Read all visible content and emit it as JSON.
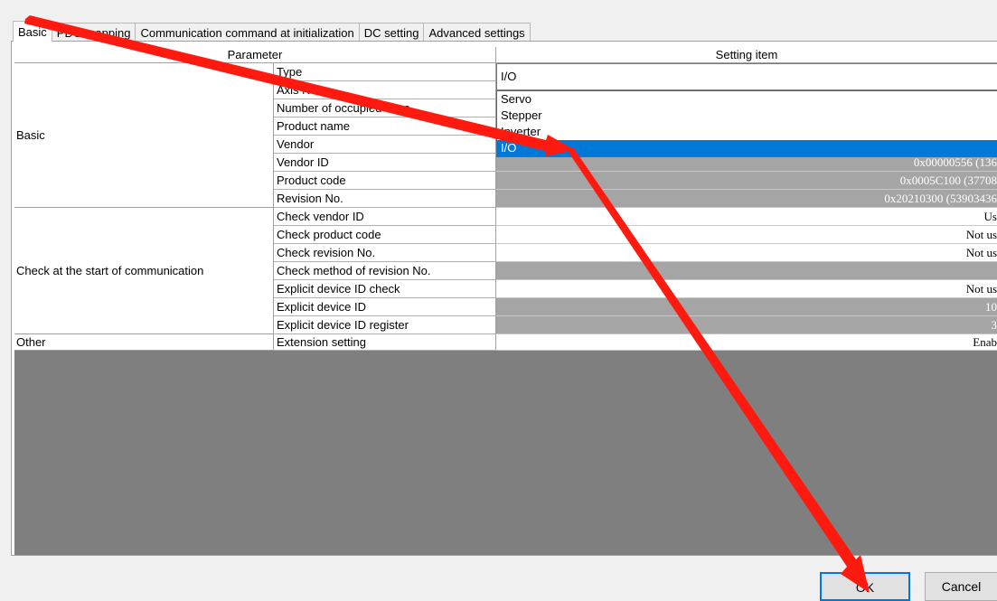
{
  "tabs": [
    "Basic",
    "PDO mapping",
    "Communication command at initialization",
    "DC setting",
    "Advanced settings"
  ],
  "header": {
    "parameter": "Parameter",
    "setting_item": "Setting item"
  },
  "groups": {
    "basic": "Basic",
    "check": "Check at the start of communication",
    "other": "Other"
  },
  "rows": [
    {
      "name": "Type",
      "value": ""
    },
    {
      "name": "Axis No.",
      "value": ""
    },
    {
      "name": "Number of occupied axes",
      "value": ""
    },
    {
      "name": "Product name",
      "value": ""
    },
    {
      "name": "Vendor",
      "value": ""
    },
    {
      "name": "Vendor ID",
      "value": "0x00000556 (136"
    },
    {
      "name": "Product code",
      "value": "0x0005C100 (37708"
    },
    {
      "name": "Revision No.",
      "value": "0x20210300 (53903436"
    },
    {
      "name": "Check vendor ID",
      "value": "Us"
    },
    {
      "name": "Check product code",
      "value": "Not us"
    },
    {
      "name": "Check revision No.",
      "value": "Not us"
    },
    {
      "name": "Check method of revision No.",
      "value": ""
    },
    {
      "name": "Explicit device ID check",
      "value": "Not us"
    },
    {
      "name": "Explicit device ID",
      "value": "10"
    },
    {
      "name": "Explicit device ID register",
      "value": "3"
    },
    {
      "name": "Extension setting",
      "value": "Enab"
    }
  ],
  "type_combo": {
    "value": "I/O",
    "options": [
      "Servo",
      "Stepper",
      "Inverter",
      "I/O"
    ],
    "selected": "I/O"
  },
  "buttons": {
    "ok": "OK",
    "cancel": "Cancel"
  },
  "colors": {
    "accent": "#0078d7",
    "annotation_arrow": "#ff1a10"
  }
}
